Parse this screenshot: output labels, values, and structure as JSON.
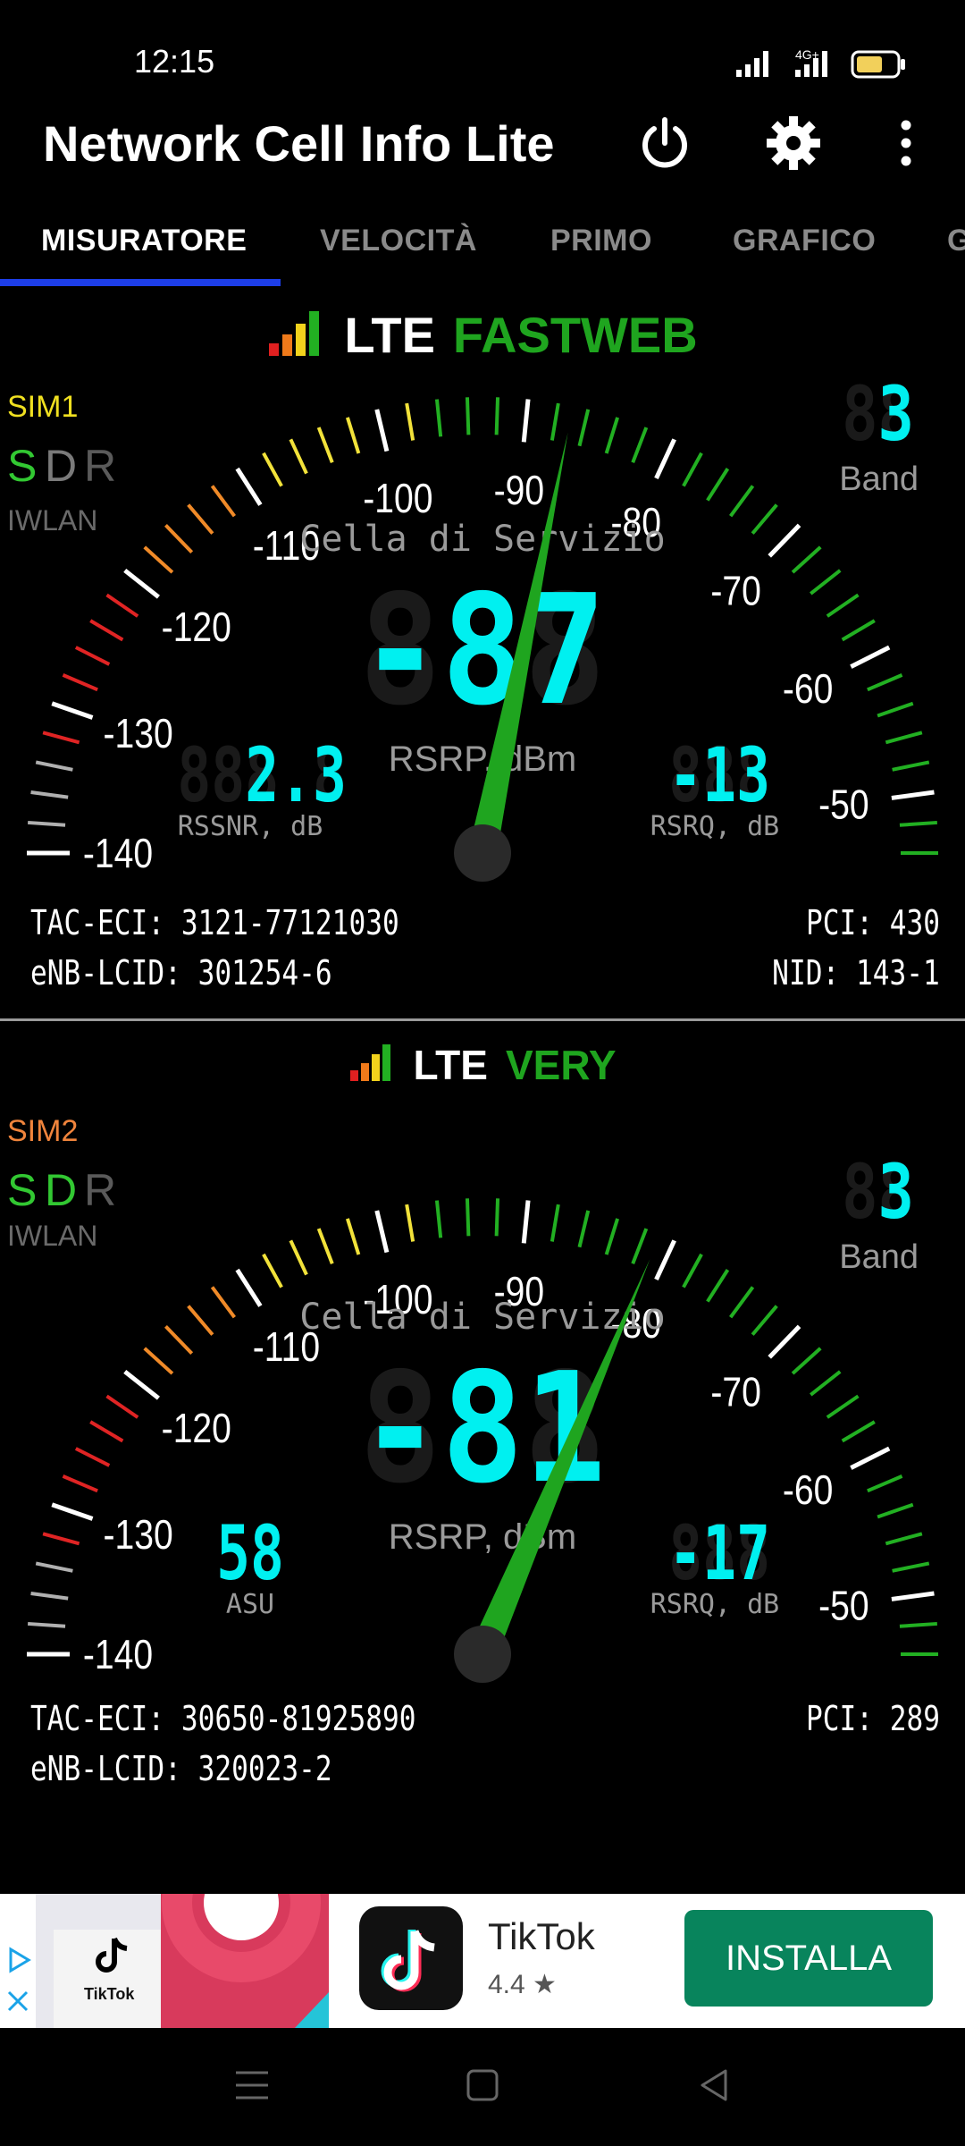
{
  "status_bar": {
    "time": "12:15",
    "network_label": "4G+"
  },
  "app": {
    "title": "Network Cell Info Lite",
    "power_icon": "power-icon",
    "settings_icon": "gear-icon",
    "menu_icon": "more-vert-icon"
  },
  "tabs": [
    {
      "label": "MISURATORE",
      "active": true
    },
    {
      "label": "VELOCITÀ",
      "active": false
    },
    {
      "label": "PRIMO",
      "active": false
    },
    {
      "label": "GRAFICO",
      "active": false
    },
    {
      "label": "G",
      "active": false
    }
  ],
  "gauge_scale": [
    "-140",
    "-130",
    "-120",
    "-110",
    "-100",
    "-90",
    "-80",
    "-70",
    "-60",
    "-50"
  ],
  "sim1": {
    "technology": "LTE",
    "operator": "FASTWEB",
    "sim_label": "SIM1",
    "s": "S",
    "d": "D",
    "r": "R",
    "iwlan": "IWLAN",
    "band": "3",
    "band_label": "Band",
    "serving_label": "Cella di Servizio",
    "rsrp": "-87",
    "rsrp_label": "RSRP, dBm",
    "left_value": "2.3",
    "left_label": "RSSNR, dB",
    "rsrq": "-13",
    "rsrq_label": "RSRQ, dB",
    "tac_eci": "TAC-ECI: 3121-77121030",
    "enb_lcid": "eNB-LCID: 301254-6",
    "pci": "PCI: 430",
    "nid": "NID: 143-1",
    "needle_value": -87,
    "bars": 4
  },
  "sim2": {
    "technology": "LTE",
    "operator": "VERY",
    "sim_label": "SIM2",
    "s": "S",
    "d": "D",
    "r": "R",
    "iwlan": "IWLAN",
    "band": "3",
    "band_label": "Band",
    "serving_label": "Cella di Servizio",
    "rsrp": "-81",
    "rsrp_label": "RSRP, dBm",
    "left_value": "58",
    "left_label": "ASU",
    "rsrq": "-17",
    "rsrq_label": "RSRQ, dB",
    "tac_eci": "TAC-ECI: 30650-81925890",
    "enb_lcid": "eNB-LCID: 320023-2",
    "pci": "PCI: 289",
    "nid": "",
    "needle_value": -81,
    "bars": 4
  },
  "ad": {
    "title": "TikTok",
    "rating": "4.4 ★",
    "install_label": "INSTALLA",
    "thumb_label": "TikTok"
  },
  "colors": {
    "accent": "#1d3ee8",
    "lcd": "#00f0f0",
    "operator": "#1fa51f",
    "needle": "#1fa51f",
    "install": "#08845c"
  }
}
